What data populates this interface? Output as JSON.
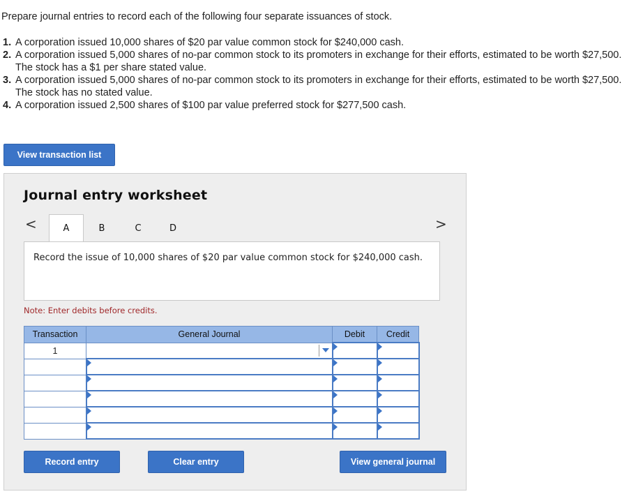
{
  "instructions": "Prepare journal entries to record each of the following four separate issuances of stock.",
  "items": [
    {
      "num": "1.",
      "text": "A corporation issued 10,000 shares of $20 par value common stock for $240,000 cash."
    },
    {
      "num": "2.",
      "text": "A corporation issued 5,000 shares of no-par common stock to its promoters in exchange for their efforts, estimated to be worth $27,500. The stock has a $1 per share stated value."
    },
    {
      "num": "3.",
      "text": "A corporation issued 5,000 shares of no-par common stock to its promoters in exchange for their efforts, estimated to be worth $27,500. The stock has no stated value."
    },
    {
      "num": "4.",
      "text": "A corporation issued 2,500 shares of $100 par value preferred stock for $277,500 cash."
    }
  ],
  "view_transaction_label": "View transaction list",
  "worksheet": {
    "title": "Journal entry worksheet",
    "prev_glyph": "<",
    "next_glyph": ">",
    "tabs": [
      "A",
      "B",
      "C",
      "D"
    ],
    "description": "Record the issue of 10,000 shares of $20 par value common stock for $240,000 cash.",
    "note": "Note: Enter debits before credits.",
    "table": {
      "headers": {
        "transaction": "Transaction",
        "general_journal": "General Journal",
        "debit": "Debit",
        "credit": "Credit"
      },
      "first_transaction": "1"
    },
    "buttons": {
      "record": "Record entry",
      "clear": "Clear entry",
      "view_journal": "View general journal"
    }
  },
  "colors": {
    "button_blue": "#3b74c7",
    "header_blue": "#96b7e6",
    "note_red": "#a0282a"
  }
}
